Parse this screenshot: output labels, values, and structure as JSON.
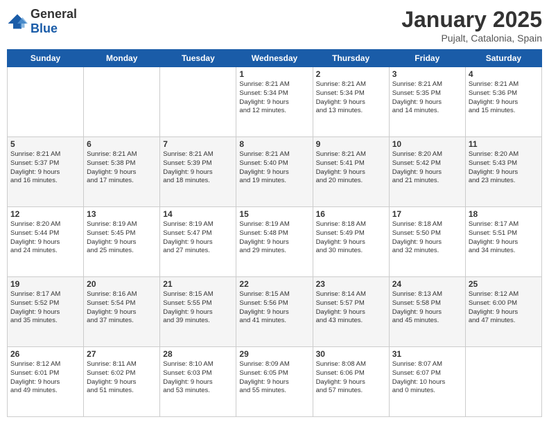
{
  "logo": {
    "general": "General",
    "blue": "Blue"
  },
  "title": "January 2025",
  "location": "Pujalt, Catalonia, Spain",
  "days_of_week": [
    "Sunday",
    "Monday",
    "Tuesday",
    "Wednesday",
    "Thursday",
    "Friday",
    "Saturday"
  ],
  "weeks": [
    [
      {
        "day": "",
        "info": ""
      },
      {
        "day": "",
        "info": ""
      },
      {
        "day": "",
        "info": ""
      },
      {
        "day": "1",
        "info": "Sunrise: 8:21 AM\nSunset: 5:34 PM\nDaylight: 9 hours\nand 12 minutes."
      },
      {
        "day": "2",
        "info": "Sunrise: 8:21 AM\nSunset: 5:34 PM\nDaylight: 9 hours\nand 13 minutes."
      },
      {
        "day": "3",
        "info": "Sunrise: 8:21 AM\nSunset: 5:35 PM\nDaylight: 9 hours\nand 14 minutes."
      },
      {
        "day": "4",
        "info": "Sunrise: 8:21 AM\nSunset: 5:36 PM\nDaylight: 9 hours\nand 15 minutes."
      }
    ],
    [
      {
        "day": "5",
        "info": "Sunrise: 8:21 AM\nSunset: 5:37 PM\nDaylight: 9 hours\nand 16 minutes."
      },
      {
        "day": "6",
        "info": "Sunrise: 8:21 AM\nSunset: 5:38 PM\nDaylight: 9 hours\nand 17 minutes."
      },
      {
        "day": "7",
        "info": "Sunrise: 8:21 AM\nSunset: 5:39 PM\nDaylight: 9 hours\nand 18 minutes."
      },
      {
        "day": "8",
        "info": "Sunrise: 8:21 AM\nSunset: 5:40 PM\nDaylight: 9 hours\nand 19 minutes."
      },
      {
        "day": "9",
        "info": "Sunrise: 8:21 AM\nSunset: 5:41 PM\nDaylight: 9 hours\nand 20 minutes."
      },
      {
        "day": "10",
        "info": "Sunrise: 8:20 AM\nSunset: 5:42 PM\nDaylight: 9 hours\nand 21 minutes."
      },
      {
        "day": "11",
        "info": "Sunrise: 8:20 AM\nSunset: 5:43 PM\nDaylight: 9 hours\nand 23 minutes."
      }
    ],
    [
      {
        "day": "12",
        "info": "Sunrise: 8:20 AM\nSunset: 5:44 PM\nDaylight: 9 hours\nand 24 minutes."
      },
      {
        "day": "13",
        "info": "Sunrise: 8:19 AM\nSunset: 5:45 PM\nDaylight: 9 hours\nand 25 minutes."
      },
      {
        "day": "14",
        "info": "Sunrise: 8:19 AM\nSunset: 5:47 PM\nDaylight: 9 hours\nand 27 minutes."
      },
      {
        "day": "15",
        "info": "Sunrise: 8:19 AM\nSunset: 5:48 PM\nDaylight: 9 hours\nand 29 minutes."
      },
      {
        "day": "16",
        "info": "Sunrise: 8:18 AM\nSunset: 5:49 PM\nDaylight: 9 hours\nand 30 minutes."
      },
      {
        "day": "17",
        "info": "Sunrise: 8:18 AM\nSunset: 5:50 PM\nDaylight: 9 hours\nand 32 minutes."
      },
      {
        "day": "18",
        "info": "Sunrise: 8:17 AM\nSunset: 5:51 PM\nDaylight: 9 hours\nand 34 minutes."
      }
    ],
    [
      {
        "day": "19",
        "info": "Sunrise: 8:17 AM\nSunset: 5:52 PM\nDaylight: 9 hours\nand 35 minutes."
      },
      {
        "day": "20",
        "info": "Sunrise: 8:16 AM\nSunset: 5:54 PM\nDaylight: 9 hours\nand 37 minutes."
      },
      {
        "day": "21",
        "info": "Sunrise: 8:15 AM\nSunset: 5:55 PM\nDaylight: 9 hours\nand 39 minutes."
      },
      {
        "day": "22",
        "info": "Sunrise: 8:15 AM\nSunset: 5:56 PM\nDaylight: 9 hours\nand 41 minutes."
      },
      {
        "day": "23",
        "info": "Sunrise: 8:14 AM\nSunset: 5:57 PM\nDaylight: 9 hours\nand 43 minutes."
      },
      {
        "day": "24",
        "info": "Sunrise: 8:13 AM\nSunset: 5:58 PM\nDaylight: 9 hours\nand 45 minutes."
      },
      {
        "day": "25",
        "info": "Sunrise: 8:12 AM\nSunset: 6:00 PM\nDaylight: 9 hours\nand 47 minutes."
      }
    ],
    [
      {
        "day": "26",
        "info": "Sunrise: 8:12 AM\nSunset: 6:01 PM\nDaylight: 9 hours\nand 49 minutes."
      },
      {
        "day": "27",
        "info": "Sunrise: 8:11 AM\nSunset: 6:02 PM\nDaylight: 9 hours\nand 51 minutes."
      },
      {
        "day": "28",
        "info": "Sunrise: 8:10 AM\nSunset: 6:03 PM\nDaylight: 9 hours\nand 53 minutes."
      },
      {
        "day": "29",
        "info": "Sunrise: 8:09 AM\nSunset: 6:05 PM\nDaylight: 9 hours\nand 55 minutes."
      },
      {
        "day": "30",
        "info": "Sunrise: 8:08 AM\nSunset: 6:06 PM\nDaylight: 9 hours\nand 57 minutes."
      },
      {
        "day": "31",
        "info": "Sunrise: 8:07 AM\nSunset: 6:07 PM\nDaylight: 10 hours\nand 0 minutes."
      },
      {
        "day": "",
        "info": ""
      }
    ]
  ]
}
